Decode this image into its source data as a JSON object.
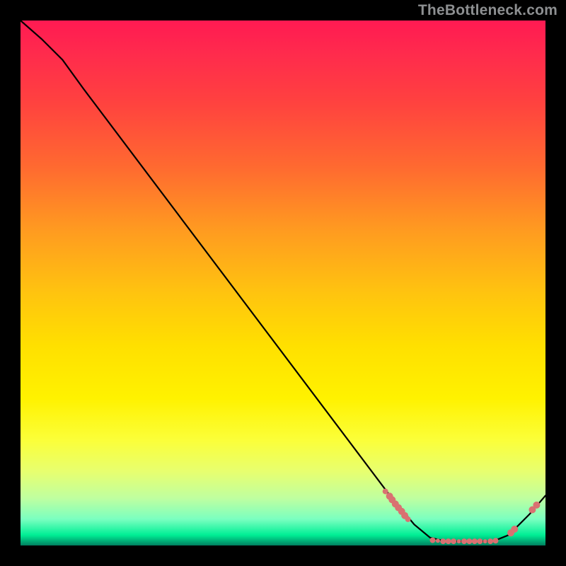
{
  "watermark": "TheBottleneck.com",
  "chart_data": {
    "type": "line",
    "title": "",
    "xlabel": "",
    "ylabel": "",
    "xlim": [
      0,
      100
    ],
    "ylim": [
      0,
      100
    ],
    "background": "red-yellow-green vertical gradient",
    "line": {
      "color": "#000000",
      "points": [
        {
          "x": 0,
          "y": 100
        },
        {
          "x": 4,
          "y": 96.5
        },
        {
          "x": 8,
          "y": 92.5
        },
        {
          "x": 12,
          "y": 87
        },
        {
          "x": 70,
          "y": 10
        },
        {
          "x": 75,
          "y": 4
        },
        {
          "x": 78,
          "y": 1.5
        },
        {
          "x": 81,
          "y": 0.8
        },
        {
          "x": 90,
          "y": 0.8
        },
        {
          "x": 93,
          "y": 2
        },
        {
          "x": 97,
          "y": 6
        },
        {
          "x": 100,
          "y": 9.5
        }
      ]
    },
    "markers": {
      "color": "#d97171",
      "radius_small": 4,
      "radius_large": 6,
      "points": [
        {
          "x": 69.5,
          "y": 10.3,
          "r": 4
        },
        {
          "x": 70.3,
          "y": 9.4,
          "r": 5
        },
        {
          "x": 70.8,
          "y": 8.7,
          "r": 5
        },
        {
          "x": 71.4,
          "y": 7.9,
          "r": 5
        },
        {
          "x": 72.0,
          "y": 7.2,
          "r": 5
        },
        {
          "x": 72.6,
          "y": 6.5,
          "r": 5
        },
        {
          "x": 73.2,
          "y": 5.7,
          "r": 5
        },
        {
          "x": 73.8,
          "y": 5.0,
          "r": 4
        },
        {
          "x": 78.5,
          "y": 1.0,
          "r": 4
        },
        {
          "x": 79.5,
          "y": 0.9,
          "r": 3
        },
        {
          "x": 80.5,
          "y": 0.8,
          "r": 4
        },
        {
          "x": 81.5,
          "y": 0.8,
          "r": 4
        },
        {
          "x": 82.5,
          "y": 0.8,
          "r": 4
        },
        {
          "x": 83.5,
          "y": 0.8,
          "r": 3
        },
        {
          "x": 84.5,
          "y": 0.8,
          "r": 4
        },
        {
          "x": 85.5,
          "y": 0.8,
          "r": 4
        },
        {
          "x": 86.5,
          "y": 0.8,
          "r": 4
        },
        {
          "x": 87.5,
          "y": 0.8,
          "r": 4
        },
        {
          "x": 88.5,
          "y": 0.8,
          "r": 3
        },
        {
          "x": 89.5,
          "y": 0.8,
          "r": 4
        },
        {
          "x": 90.5,
          "y": 0.9,
          "r": 4
        },
        {
          "x": 93.4,
          "y": 2.4,
          "r": 5
        },
        {
          "x": 94.1,
          "y": 3.1,
          "r": 5
        },
        {
          "x": 97.5,
          "y": 6.8,
          "r": 5
        },
        {
          "x": 98.3,
          "y": 7.7,
          "r": 5
        }
      ]
    }
  }
}
